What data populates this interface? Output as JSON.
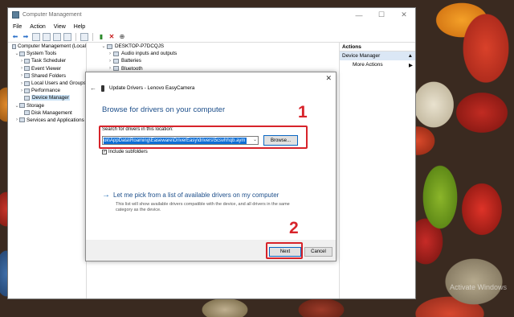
{
  "window": {
    "title": "Computer Management",
    "controls": {
      "minimize": "—",
      "maximize": "☐",
      "close": "✕"
    }
  },
  "menu": [
    "File",
    "Action",
    "View",
    "Help"
  ],
  "tree": [
    {
      "label": "Computer Management (Local",
      "exp": "",
      "indent": 0
    },
    {
      "label": "System Tools",
      "exp": "⌄",
      "indent": 1
    },
    {
      "label": "Task Scheduler",
      "exp": "›",
      "indent": 2
    },
    {
      "label": "Event Viewer",
      "exp": "›",
      "indent": 2
    },
    {
      "label": "Shared Folders",
      "exp": "›",
      "indent": 2
    },
    {
      "label": "Local Users and Groups",
      "exp": "›",
      "indent": 2
    },
    {
      "label": "Performance",
      "exp": "›",
      "indent": 2
    },
    {
      "label": "Device Manager",
      "exp": "",
      "indent": 2,
      "selected": true
    },
    {
      "label": "Storage",
      "exp": "⌄",
      "indent": 1
    },
    {
      "label": "Disk Management",
      "exp": "",
      "indent": 2
    },
    {
      "label": "Services and Applications",
      "exp": "›",
      "indent": 1
    }
  ],
  "devices": [
    {
      "label": "DESKTOP-P7DCQJS",
      "exp": "⌄"
    },
    {
      "label": "Audio inputs and outputs",
      "exp": "›"
    },
    {
      "label": "Batteries",
      "exp": "›"
    },
    {
      "label": "Bluetooth",
      "exp": "›"
    }
  ],
  "actions": {
    "header": "Actions",
    "section": "Device Manager",
    "more": "More Actions"
  },
  "dialog": {
    "close": "✕",
    "header": "Update Drivers - Lenovo EasyCamera",
    "title": "Browse for drivers on your computer",
    "search_label": "Search for drivers in this location:",
    "path": "ok\\AppData\\Roaming\\Easeware\\DriverEasy\\drivers\\5csvhhqb.aym",
    "browse": "Browse...",
    "include_subfolders": "Include subfolders",
    "include_subfolders_checked": true,
    "pick_title": "Let me pick from a list of available drivers on my computer",
    "pick_desc": "This list will show available drivers compatible with the device, and all drivers in the same category as the device.",
    "next": "Next",
    "cancel": "Cancel"
  },
  "annotations": {
    "step1": "1",
    "step2": "2"
  },
  "watermark": "Activate Windows",
  "colors": {
    "highlight": "#d7232a",
    "link": "#1c4e8a",
    "selection": "#0f6fd6"
  }
}
